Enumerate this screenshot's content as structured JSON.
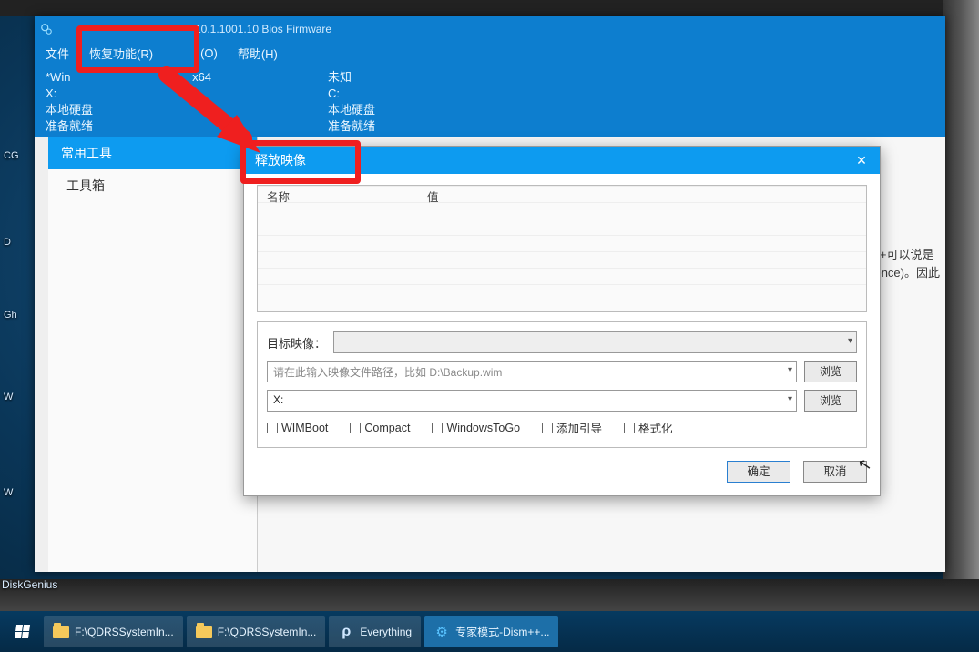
{
  "app": {
    "title_suffix": "10.1.1001.10 Bios Firmware",
    "menu": {
      "file": "文件",
      "recover": "恢复功能(R)",
      "options_partial": "(O)",
      "help": "帮助(H)"
    }
  },
  "drives": {
    "left": {
      "l1": "*Win",
      "l1b": " x64",
      "l2": "X:",
      "l3": "本地硬盘",
      "l4": "准备就绪"
    },
    "right": {
      "l1": "未知",
      "l2": "C:",
      "l3": "本地硬盘",
      "l4": "准备就绪"
    }
  },
  "sidebar": {
    "active": "常用工具",
    "item1": "工具箱"
  },
  "side_labels": {
    "cg": "CG",
    "d": "D",
    "gh": "Gh",
    "w1": "W",
    "w2": "W",
    "diskgenius": "DiskGenius"
  },
  "main_hint": {
    "line1": "Dism++可以说是",
    "line2": "Reference)。因此"
  },
  "dialog": {
    "title": "释放映像",
    "col_name": "名称",
    "col_value": "值",
    "target_label": "目标映像：",
    "path_placeholder": "请在此输入映像文件路径，比如 D:\\Backup.wim",
    "drive_value": "X:",
    "browse": "浏览",
    "checks": {
      "wimboot": "WIMBoot",
      "compact": "Compact",
      "wtg": "WindowsToGo",
      "addboot": "添加引导",
      "format": "格式化"
    },
    "ok": "确定",
    "cancel": "取消"
  },
  "taskbar": {
    "item1": "F:\\QDRSSystemIn...",
    "item2": "F:\\QDRSSystemIn...",
    "item3": "Everything",
    "item4": "专家模式-Dism++..."
  }
}
